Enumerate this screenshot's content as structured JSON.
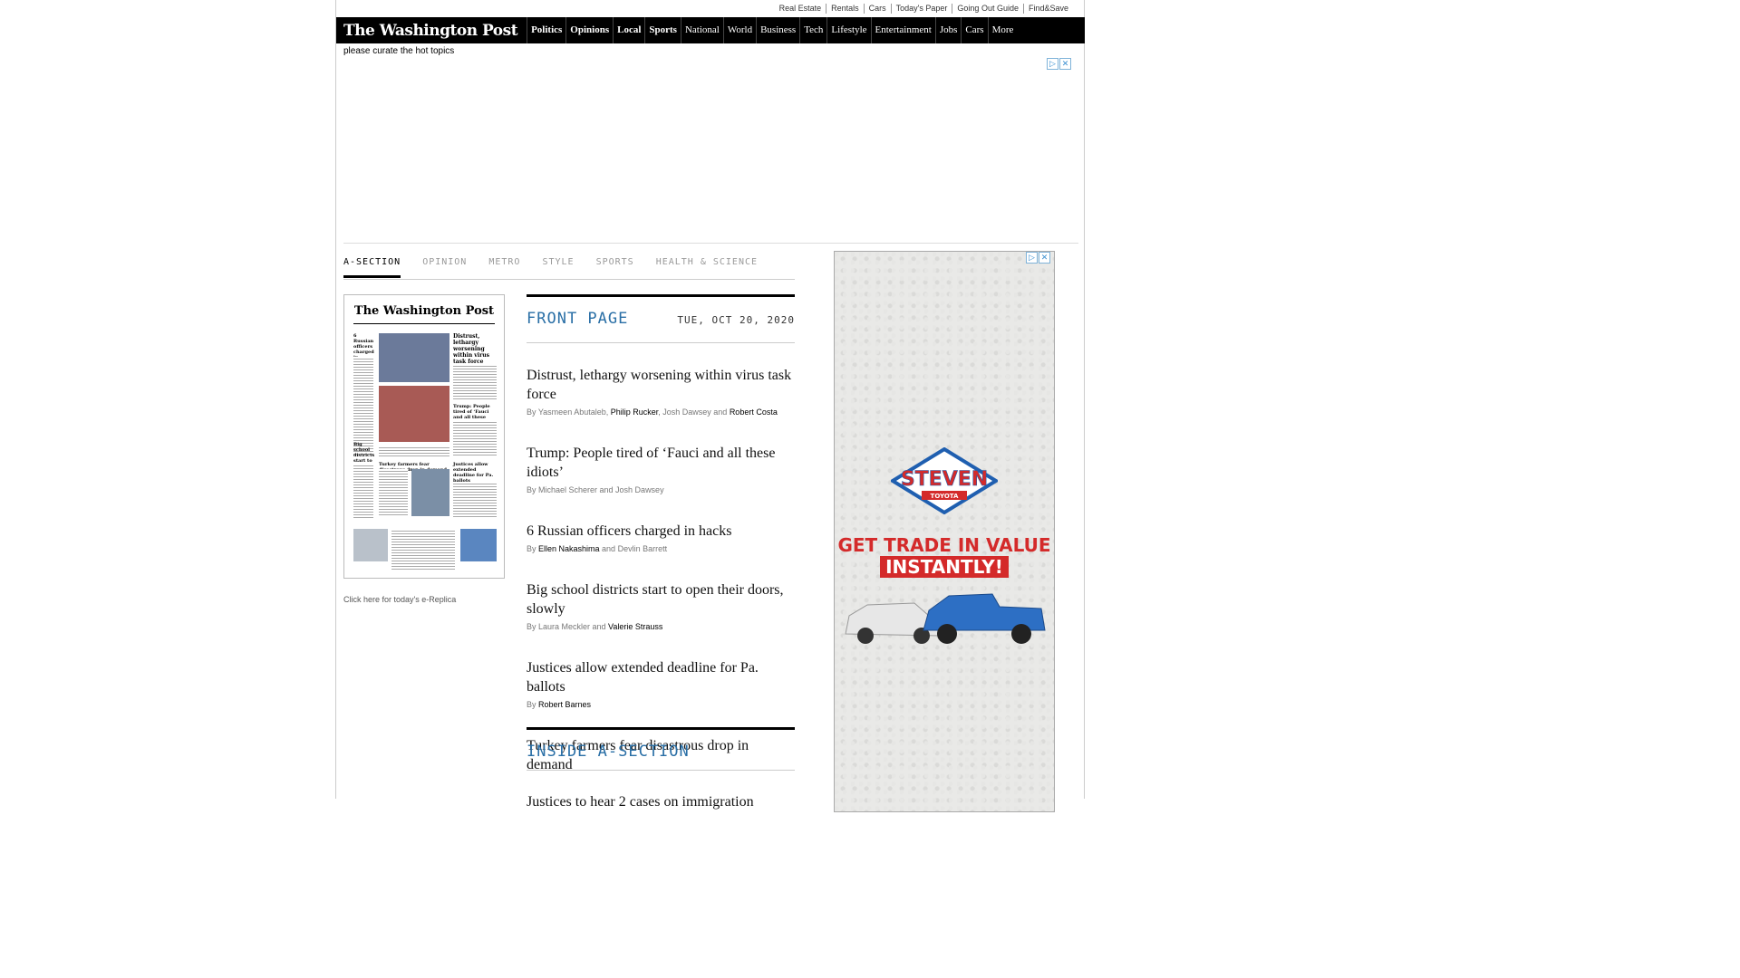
{
  "utility_links": [
    "Real Estate",
    "Rentals",
    "Cars",
    "Today's Paper",
    "Going Out Guide",
    "Find&Save"
  ],
  "logo": "The Washington Post",
  "nav": [
    {
      "label": "Politics",
      "bold": true
    },
    {
      "label": "Opinions",
      "bold": true
    },
    {
      "label": "Local",
      "bold": true
    },
    {
      "label": "Sports",
      "bold": true
    },
    {
      "label": "National",
      "bold": false
    },
    {
      "label": "World",
      "bold": false
    },
    {
      "label": "Business",
      "bold": false
    },
    {
      "label": "Tech",
      "bold": false
    },
    {
      "label": "Lifestyle",
      "bold": false
    },
    {
      "label": "Entertainment",
      "bold": false
    },
    {
      "label": "Jobs",
      "bold": false
    },
    {
      "label": "Cars",
      "bold": false
    },
    {
      "label": "More",
      "bold": false
    }
  ],
  "curate_text": "please curate the hot topics",
  "section_tabs": [
    {
      "label": "A-SECTION",
      "active": true
    },
    {
      "label": "OPINION",
      "active": false
    },
    {
      "label": "METRO",
      "active": false
    },
    {
      "label": "STYLE",
      "active": false
    },
    {
      "label": "SPORTS",
      "active": false
    },
    {
      "label": "HEALTH & SCIENCE",
      "active": false
    }
  ],
  "front_page": {
    "title": "FRONT PAGE",
    "date": "TUE, OCT 20, 2020",
    "stories": [
      {
        "headline": "Distrust, lethargy worsening within virus task force",
        "byline": [
          {
            "t": "By Yasmeen Abutaleb, ",
            "link": false
          },
          {
            "t": "Philip Rucker",
            "link": true
          },
          {
            "t": ", Josh Dawsey and ",
            "link": false
          },
          {
            "t": "Robert Costa",
            "link": true
          }
        ]
      },
      {
        "headline": "Trump: People tired of ‘Fauci and all these idiots’",
        "byline": [
          {
            "t": "By Michael Scherer and Josh Dawsey",
            "link": false
          }
        ]
      },
      {
        "headline": "6 Russian officers charged in hacks",
        "byline": [
          {
            "t": "By ",
            "link": false
          },
          {
            "t": "Ellen Nakashima",
            "link": true
          },
          {
            "t": " and Devlin Barrett",
            "link": false
          }
        ]
      },
      {
        "headline": "Big school districts start to open their doors, slowly",
        "byline": [
          {
            "t": "By Laura Meckler and ",
            "link": false
          },
          {
            "t": "Valerie Strauss",
            "link": true
          }
        ]
      },
      {
        "headline": "Justices allow extended deadline for Pa. ballots",
        "byline": [
          {
            "t": "By ",
            "link": false
          },
          {
            "t": "Robert Barnes",
            "link": true
          }
        ]
      },
      {
        "headline": "Turkey farmers fear disastrous drop in demand",
        "byline": []
      }
    ]
  },
  "replica_link": "Click here for today's e-Replica",
  "inside": {
    "title": "INSIDE A-SECTION",
    "first_headline": "Justices to hear 2 cases on immigration"
  },
  "thumbnail_masthead": "The Washington Post",
  "thumbnail_headlines": [
    "6 Russian officers charged in hacks",
    "Distrust, lethargy worsening within virus task force",
    "Trump: People tired of ‘Fauci and all these idiots’",
    "Big school districts start to open their doors, slowly",
    "Turkey farmers fear disastrous drop in demand",
    "Justices allow extended deadline for Pa. ballots"
  ],
  "ad": {
    "brand": "STEVEN",
    "sub_brand": "TOYOTA",
    "line1": "GET TRADE IN VALUE",
    "line2": "INSTANTLY!",
    "colors": {
      "red": "#d42a2a",
      "blue": "#1f5fb0"
    }
  }
}
